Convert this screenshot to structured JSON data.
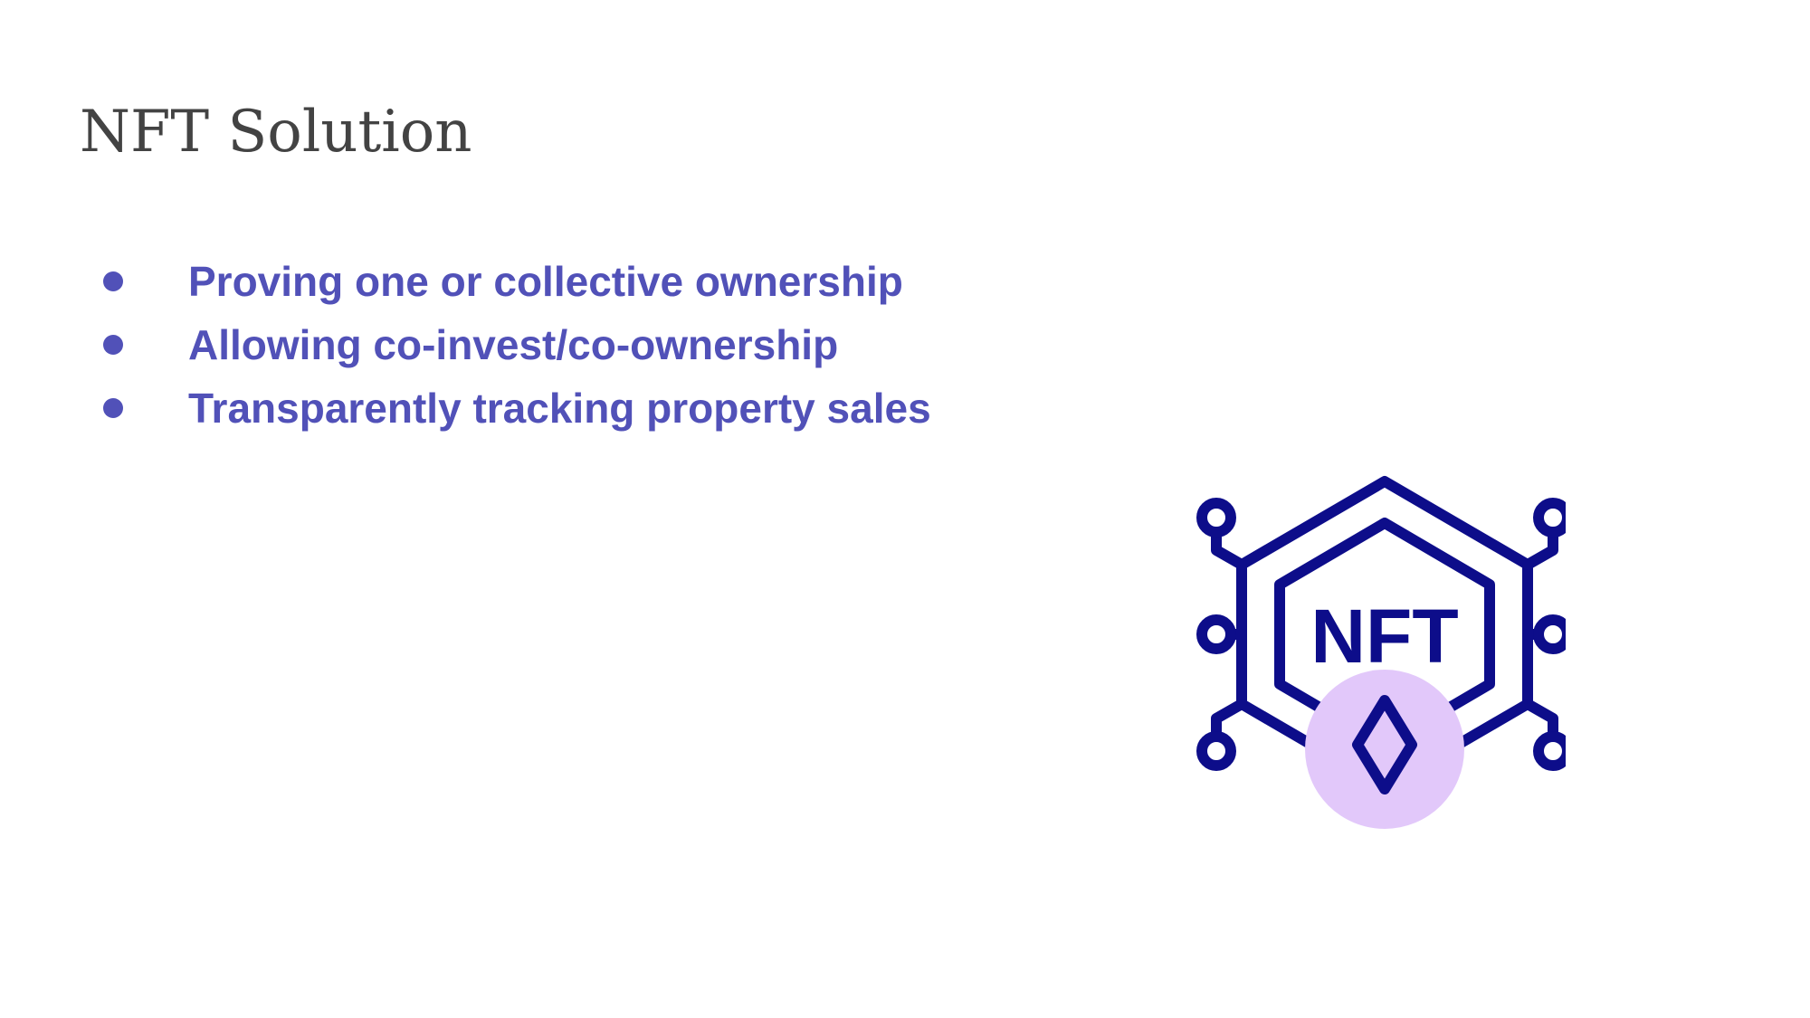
{
  "slide": {
    "title": "NFT Solution",
    "bullets": [
      "Proving one or collective ownership",
      "Allowing co-invest/co-ownership",
      "Transparently tracking property sales"
    ],
    "icon": {
      "name": "nft-hexagon-icon",
      "label": "NFT",
      "colors": {
        "stroke": "#0d0d8a",
        "badge": "#e2c8fa"
      }
    },
    "colors": {
      "title": "#434343",
      "bullet_text": "#5151b8",
      "background": "#ffffff"
    }
  }
}
